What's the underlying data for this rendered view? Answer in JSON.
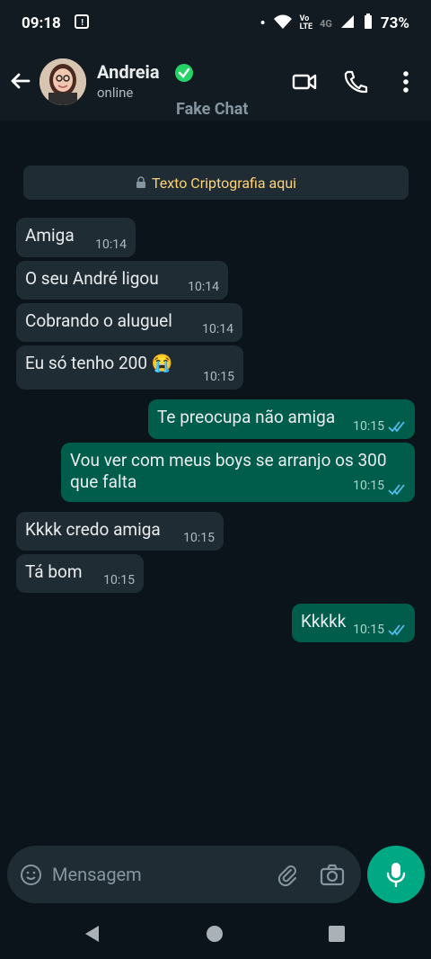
{
  "status": {
    "time": "09:18",
    "network_top": "Vo",
    "network_bottom": "LTE",
    "signal_gen": "4G",
    "battery": "73%"
  },
  "header": {
    "contact_name": "Andreia",
    "status": "online",
    "subtitle": "Fake Chat",
    "icons": [
      "back-arrow-icon",
      "verified-icon",
      "video-call-icon",
      "phone-icon",
      "more-icon"
    ]
  },
  "banner": {
    "text": "Texto Criptografia aqui"
  },
  "messages": [
    {
      "type": "in",
      "text": "Amiga",
      "time": "10:14"
    },
    {
      "type": "in",
      "text": "O seu André ligou",
      "time": "10:14"
    },
    {
      "type": "in",
      "text": "Cobrando o aluguel",
      "time": "10:14"
    },
    {
      "type": "in",
      "text": "Eu só tenho 200 😭",
      "time": "10:15"
    },
    {
      "type": "out",
      "text": "Te preocupa não amiga",
      "time": "10:15"
    },
    {
      "type": "out",
      "text": "Vou ver com meus boys se arranjo os 300 que falta",
      "time": "10:15"
    },
    {
      "type": "in",
      "text": "Kkkk credo amiga",
      "time": "10:15"
    },
    {
      "type": "in",
      "text": "Tá bom",
      "time": "10:15"
    },
    {
      "type": "out",
      "text": "Kkkkk",
      "time": "10:15"
    }
  ],
  "input": {
    "placeholder": "Mensagem"
  },
  "colors": {
    "background": "#0b141a",
    "header": "#111b21",
    "incoming": "#202c33",
    "outgoing": "#005c4b",
    "accent": "#00a884",
    "crypto_text": "#ffd279"
  }
}
